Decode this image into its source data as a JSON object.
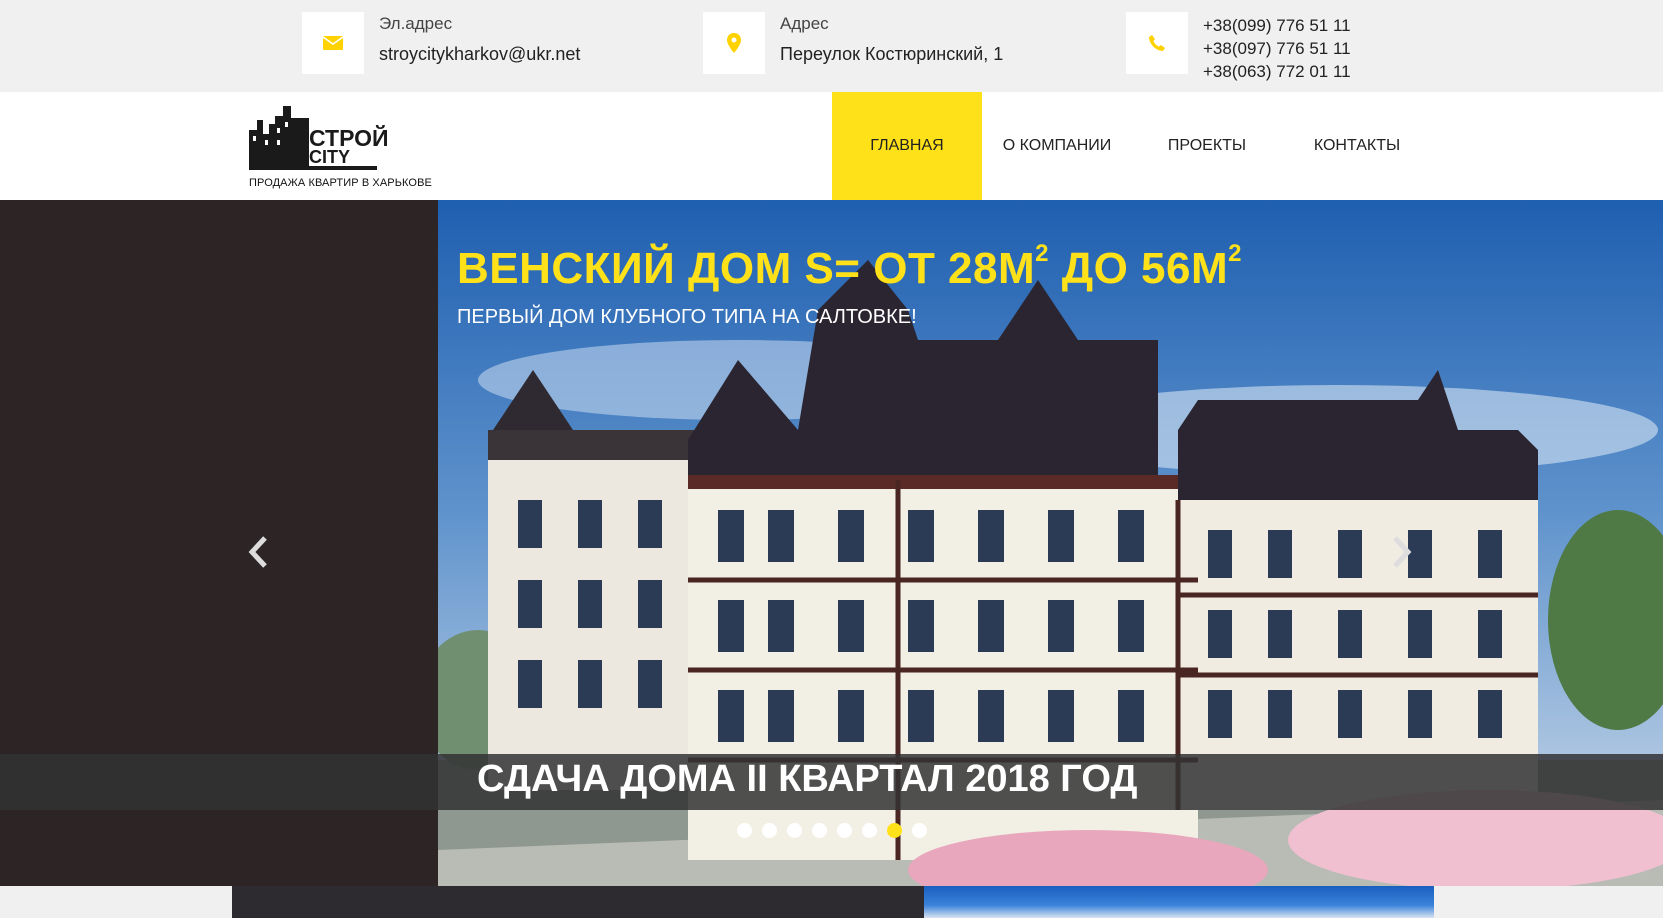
{
  "colors": {
    "accent": "#ffe11a",
    "dark": "#2d2426",
    "topbar": "#f0f0f0"
  },
  "contacts": {
    "email": {
      "icon": "envelope-icon",
      "label": "Эл.адрес",
      "value": "stroycitykharkov@ukr.net"
    },
    "address": {
      "icon": "map-pin-icon",
      "label": "Адрес",
      "value": "Переулок Костюринский, 1"
    },
    "phones": {
      "icon": "phone-icon",
      "items": [
        "+38(099) 776 51 11",
        "+38(097) 776 51 11",
        "+38(063) 772 01 11"
      ]
    }
  },
  "logo": {
    "line1": "СТРОЙ",
    "line2": "CITY",
    "subtitle": "ПРОДАЖА КВАРТИР В ХАРЬКОВЕ"
  },
  "nav": {
    "items": [
      {
        "label": "ГЛАВНАЯ",
        "active": true
      },
      {
        "label": "О КОМПАНИИ",
        "active": false
      },
      {
        "label": "ПРОЕКТЫ",
        "active": false
      },
      {
        "label": "КОНТАКТЫ",
        "active": false
      }
    ]
  },
  "slider": {
    "title_main": "ВЕНСКИЙ ДОМ S= ОТ 28М",
    "title_sup1": "2",
    "title_mid": " ДО 56М",
    "title_sup2": "2",
    "subtitle": "ПЕРВЫЙ ДОМ КЛУБНОГО ТИПА НА САЛТОВКЕ!",
    "caption": "СДАЧА ДОМА II КВАРТАЛ 2018 ГОД",
    "dots_total": 8,
    "active_dot": 7,
    "prev_icon": "chevron-left-icon",
    "next_icon": "chevron-right-icon"
  }
}
